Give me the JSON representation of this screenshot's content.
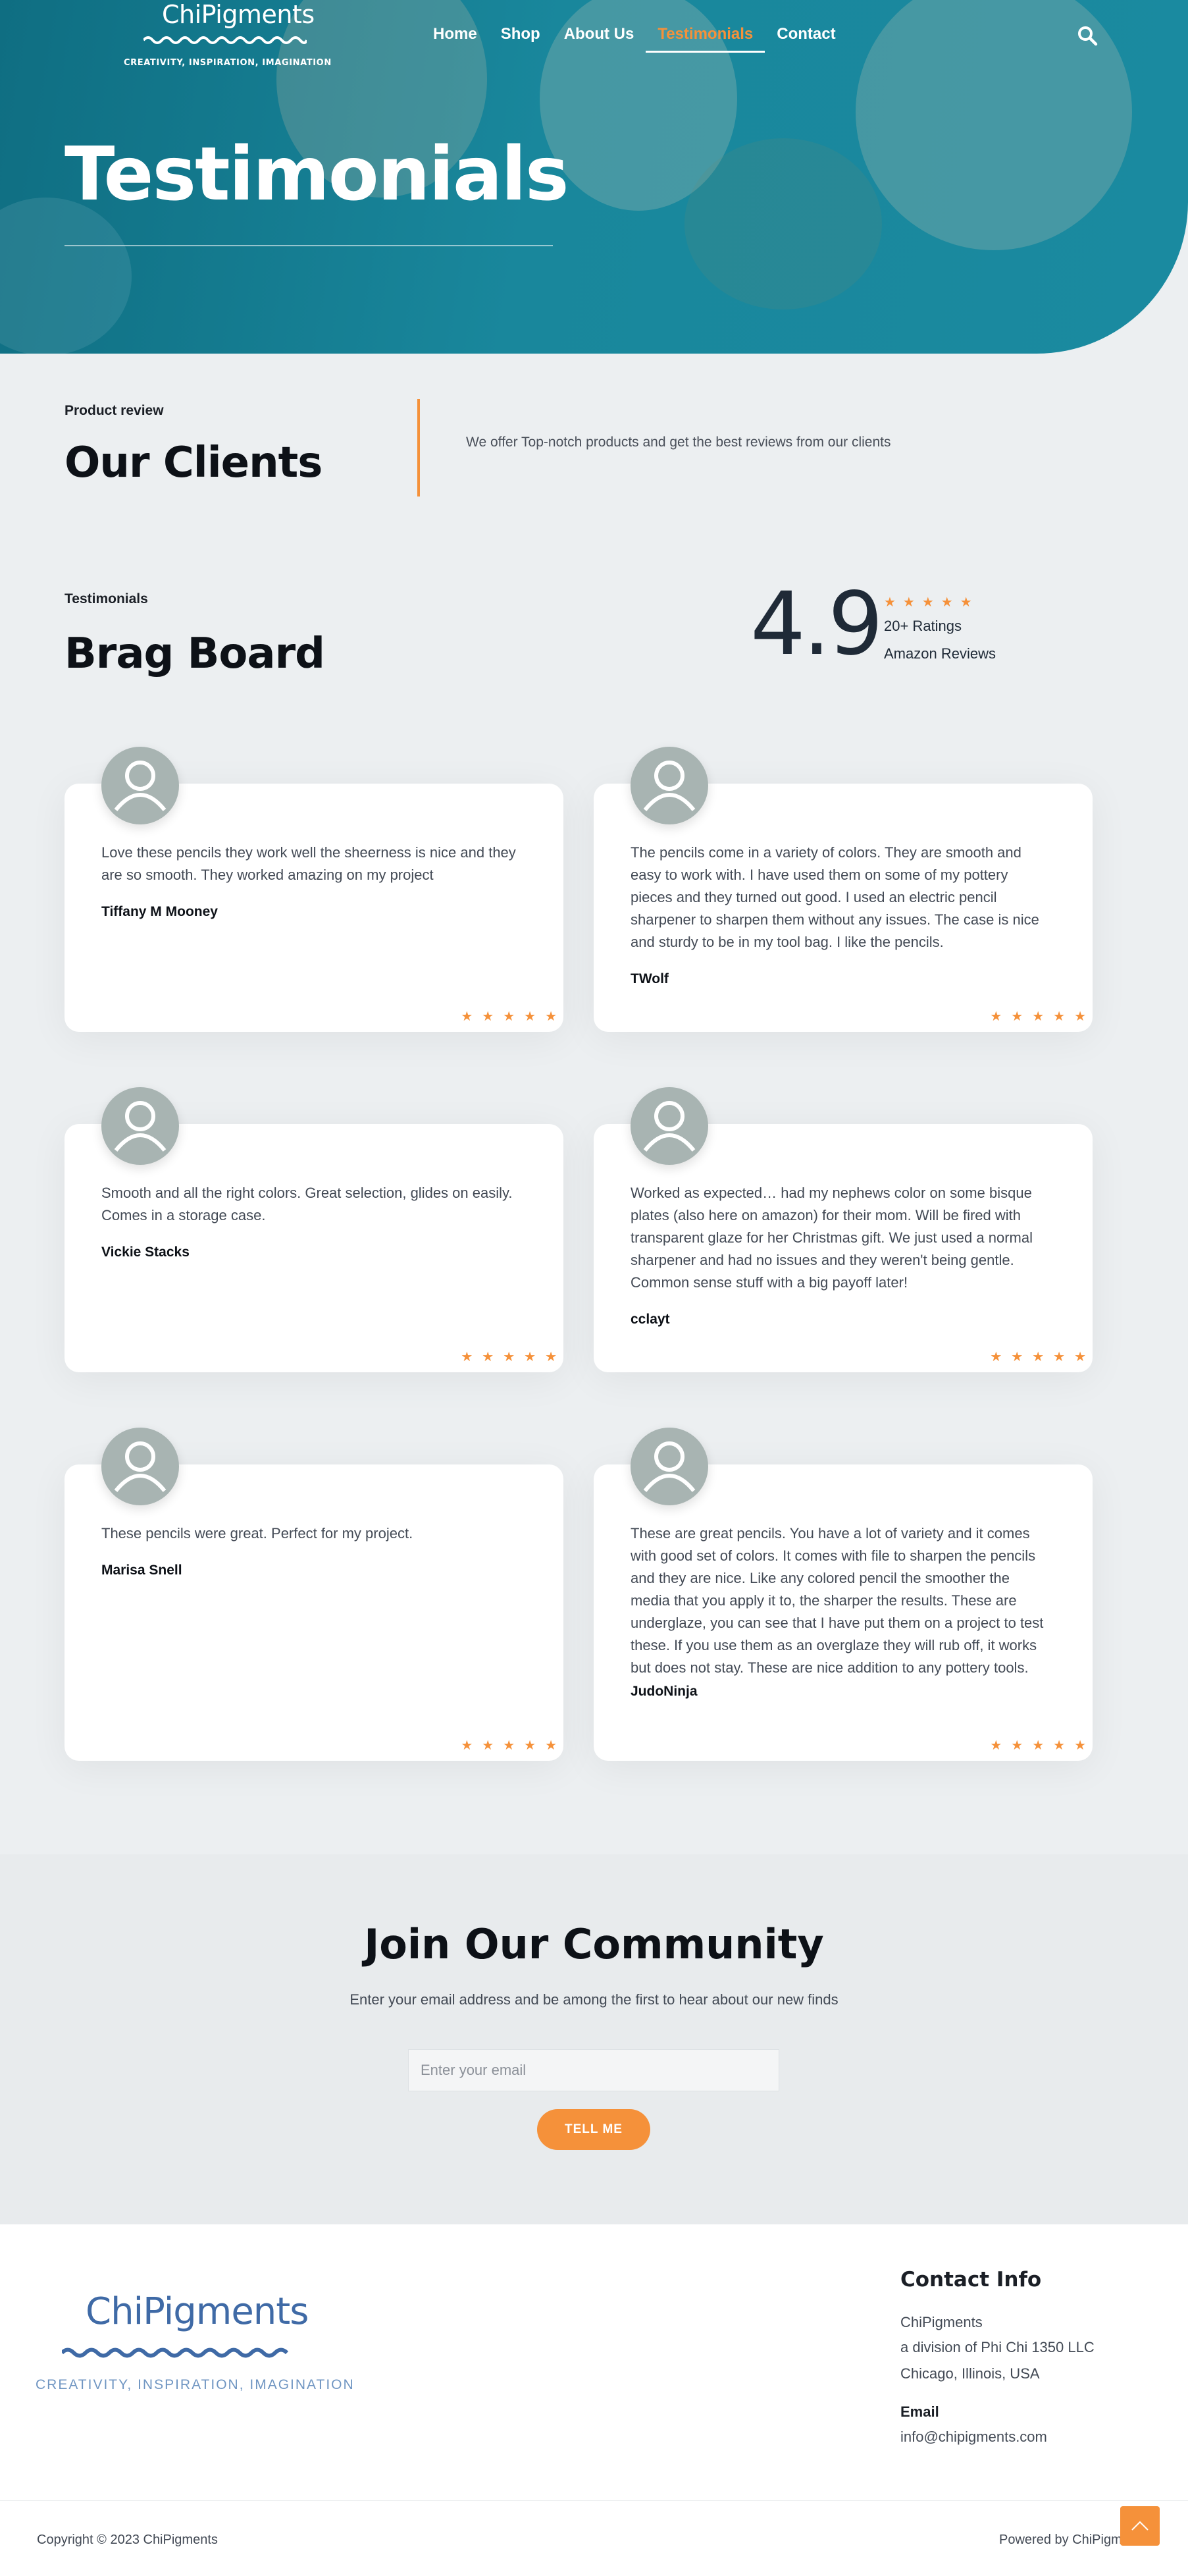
{
  "brand": {
    "logo_text": "ChiPigments",
    "tagline": "CREATIVITY,  INSPIRATION,  IMAGINATION",
    "accent_color": "#f5913a",
    "hero_color": "#147b90"
  },
  "nav": {
    "items": [
      {
        "label": "Home",
        "active": false
      },
      {
        "label": "Shop",
        "active": false
      },
      {
        "label": "About Us",
        "active": false
      },
      {
        "label": "Testimonials",
        "active": true
      },
      {
        "label": "Contact",
        "active": false
      }
    ],
    "search_icon": "search-icon"
  },
  "hero": {
    "title": "Testimonials"
  },
  "clients": {
    "kicker": "Product review",
    "title": "Our Clients",
    "description": "We offer Top-notch products and get the best reviews from our clients"
  },
  "brag": {
    "kicker": "Testimonials",
    "title": "Brag Board",
    "rating": "4.9",
    "stars": "★★★★★",
    "ratings_count": "20+ Ratings",
    "ratings_source": "Amazon Reviews"
  },
  "reviews": [
    {
      "text": "Love these pencils they work well the sheerness is nice and they are so smooth. They worked amazing on my project",
      "author": "Tiffany M Mooney",
      "stars": "★★★★★",
      "rating": 5
    },
    {
      "text": "The pencils come in a variety of colors. They are smooth and easy to work with. I have used them on some of my pottery pieces and they turned out good. I used an electric pencil sharpener to sharpen them without any issues. The case is nice and sturdy to be in my tool bag. I like the pencils.",
      "author": "TWolf",
      "stars": "★★★★★",
      "rating": 5
    },
    {
      "text": "Smooth and all the right colors. Great selection, glides on easily. Comes in a storage case.",
      "author": "Vickie Stacks",
      "stars": "★★★★★",
      "rating": 5
    },
    {
      "text": "Worked as expected… had my nephews color on some bisque plates (also here on amazon) for their mom. Will be fired with transparent glaze for her Christmas gift. We just used a normal sharpener and had no issues and they weren't being gentle. Common sense stuff with a big payoff later!",
      "author": "cclayt",
      "stars": "★★★★★",
      "rating": 5
    },
    {
      "text": "These pencils were great. Perfect for my project.",
      "author": "Marisa Snell",
      "stars": "★★★★★",
      "rating": 5
    },
    {
      "text": "These are great pencils. You have a lot of variety and it comes with good set of colors. It comes with file to sharpen the pencils and they are nice. Like any colored pencil the smoother the media that you apply it to, the sharper the results. These are underglaze, you can see that I have put them on a project to test these. If you use them as an overglaze they will rub off, it works but does not stay. These are nice addition to any pottery tools.",
      "author": "JudoNinja",
      "stars": "★★★★★",
      "rating": 5
    }
  ],
  "community": {
    "title": "Join Our Community",
    "subtitle": "Enter your email address and be among the first to hear about our new finds",
    "email_placeholder": "Enter your email",
    "email_value": "",
    "button_label": "TELL ME"
  },
  "footer": {
    "logo_text": "ChiPigments",
    "tagline": "CREATIVITY, INSPIRATION, IMAGINATION",
    "contact_title": "Contact Info",
    "company": "ChiPigments",
    "division": "a division of Phi Chi 1350 LLC",
    "city": "Chicago, Illinois, USA",
    "email_label": "Email",
    "email": "info@chipigments.com",
    "copyright": "Copyright © 2023 ChiPigments",
    "powered": "Powered by ChiPigments"
  }
}
